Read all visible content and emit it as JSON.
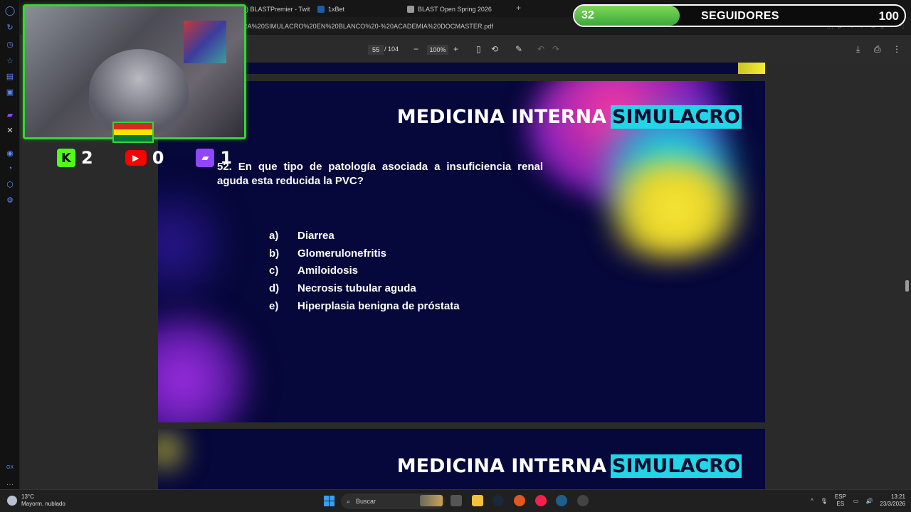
{
  "browser": {
    "tabs": [
      {
        "label": "(10) BLASTPremier - Twit",
        "color": "#9146ff"
      },
      {
        "label": "1xBet",
        "color": "#1a5ea8"
      },
      {
        "label": "BLAST Open Spring 2026",
        "color": "#999999"
      }
    ],
    "url": "RA%20SIMULACRO%20EN%20BLANCO%20-%20ACADEMIA%20DOCMASTER.pdf"
  },
  "pdf": {
    "page_current": "55",
    "page_total": "/ 104",
    "zoom": "100%",
    "zoom_out": "−",
    "zoom_in": "+"
  },
  "slide": {
    "title": "MEDICINA INTERNA",
    "title_highlight": "SIMULACRO",
    "question": "52. En que tipo de patología asociada a insuficiencia renal aguda esta reducida la PVC?",
    "options": [
      {
        "letter": "a)",
        "text": "Diarrea"
      },
      {
        "letter": "b)",
        "text": "Glomerulonefritis"
      },
      {
        "letter": "c)",
        "text": "Amiloidosis"
      },
      {
        "letter": "d)",
        "text": "Necrosis tubular aguda"
      },
      {
        "letter": "e)",
        "text": "Hiperplasia benigna de próstata"
      }
    ]
  },
  "next_slide": {
    "title": "MEDICINA INTERNA",
    "title_highlight": "SIMULACRO"
  },
  "stream": {
    "kick_count": "2",
    "youtube_count": "0",
    "twitch_count": "1",
    "followers_current": "32",
    "followers_label": "SEGUIDORES",
    "followers_goal": "100",
    "followers_progress": 0.32
  },
  "taskbar": {
    "temperature": "13°C",
    "weather": "Mayorm. nublado",
    "search_placeholder": "Buscar",
    "lang_top": "ESP",
    "lang_bottom": "ES",
    "time": "13:21",
    "date": "23/3/2026"
  },
  "colors": {
    "accent_cyan": "#21d6e6",
    "overlay_green": "#3bd23b",
    "slide_bg": "#06073a"
  }
}
